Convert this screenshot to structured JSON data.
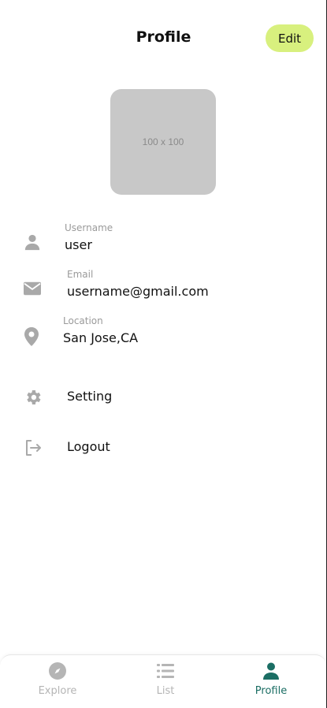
{
  "header": {
    "title": "Profile",
    "edit_label": "Edit"
  },
  "avatar": {
    "placeholder_text": "100 x 100"
  },
  "info": {
    "username": {
      "label": "Username",
      "value": "user",
      "icon": "person-icon"
    },
    "email": {
      "label": "Email",
      "value": "username@gmail.com",
      "icon": "envelope-icon"
    },
    "location": {
      "label": "Location",
      "value": "San Jose,CA",
      "icon": "location-pin-icon"
    }
  },
  "actions": {
    "setting": {
      "label": "Setting",
      "icon": "gear-icon"
    },
    "logout": {
      "label": "Logout",
      "icon": "logout-icon"
    }
  },
  "nav": {
    "items": [
      {
        "label": "Explore",
        "icon": "compass-icon"
      },
      {
        "label": "List",
        "icon": "list-icon"
      },
      {
        "label": "Profile",
        "icon": "person-icon"
      }
    ],
    "active": "Profile"
  },
  "colors": {
    "accent": "#d8f07e",
    "active_nav": "#1b6e64",
    "inactive": "#b5b5b5",
    "icon_gray": "#a9a9a9",
    "avatar_bg": "#c8c8c8"
  }
}
